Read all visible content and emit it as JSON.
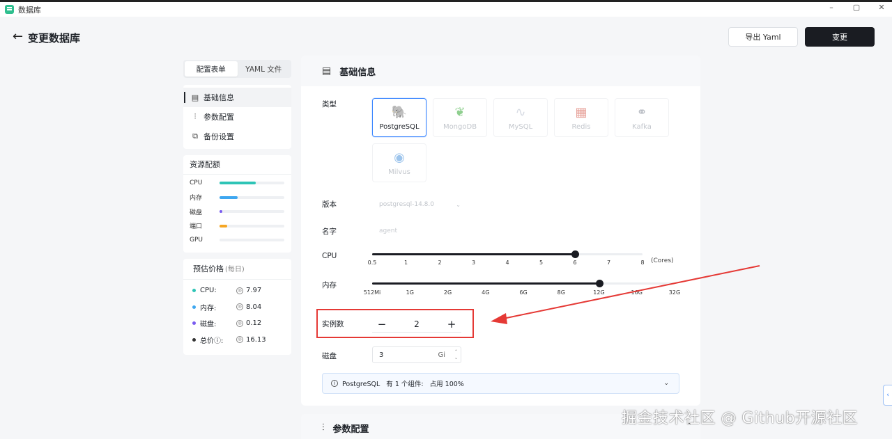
{
  "window": {
    "app_title": "数据库",
    "minimize": "–",
    "maximize": "▢",
    "close": "✕"
  },
  "header": {
    "back_icon": "←",
    "title": "变更数据库",
    "export_label": "导出 Yaml",
    "submit_label": "变更"
  },
  "mode_tabs": [
    {
      "label": "配置表单",
      "active": true
    },
    {
      "label": "YAML 文件",
      "active": false
    }
  ],
  "nav": [
    {
      "label": "基础信息",
      "icon": "form-icon",
      "active": true
    },
    {
      "label": "参数配置",
      "icon": "sliders-icon",
      "active": false
    },
    {
      "label": "备份设置",
      "icon": "backup-icon",
      "active": false
    }
  ],
  "resources": {
    "title": "资源配额",
    "items": [
      {
        "label": "CPU",
        "fraction": 0.56,
        "color": "#2ec4b6"
      },
      {
        "label": "内存",
        "fraction": 0.28,
        "color": "#3ea7f0"
      },
      {
        "label": "磁盘",
        "fraction": 0.04,
        "color": "#7a5cf0"
      },
      {
        "label": "端口",
        "fraction": 0.12,
        "color": "#f5a623"
      },
      {
        "label": "GPU",
        "fraction": 0.0,
        "color": "#cccccc"
      }
    ]
  },
  "price": {
    "title": "预估价格",
    "subtitle": "(每日)",
    "items": [
      {
        "label": "CPU:",
        "value": "7.97",
        "color": "#2ec4b6"
      },
      {
        "label": "内存:",
        "value": "8.04",
        "color": "#3ea7f0"
      },
      {
        "label": "磁盘:",
        "value": "0.12",
        "color": "#7a5cf0"
      },
      {
        "label": "总价ⓘ:",
        "value": "16.13",
        "color": "#333333"
      }
    ]
  },
  "basic": {
    "title": "基础信息",
    "type_label": "类型",
    "db_types": [
      {
        "name": "PostgreSQL",
        "icon": "postgresql-icon",
        "active": true
      },
      {
        "name": "MongoDB",
        "icon": "mongodb-icon",
        "active": false
      },
      {
        "name": "MySQL",
        "icon": "mysql-icon",
        "active": false
      },
      {
        "name": "Redis",
        "icon": "redis-icon",
        "active": false
      },
      {
        "name": "Kafka",
        "icon": "kafka-icon",
        "active": false
      },
      {
        "name": "Milvus",
        "icon": "milvus-icon",
        "active": false
      }
    ],
    "version_label": "版本",
    "version_value": "postgresql-14.8.0",
    "name_label": "名字",
    "name_value": "agent",
    "cpu_label": "CPU",
    "cpu_ticks": [
      "0.5",
      "1",
      "2",
      "3",
      "4",
      "5",
      "6",
      "7",
      "8"
    ],
    "cpu_selected": "6",
    "cpu_unit": "(Cores)",
    "mem_label": "内存",
    "mem_ticks": [
      "512Mi",
      "1G",
      "2G",
      "4G",
      "6G",
      "8G",
      "12G",
      "16G",
      "32G"
    ],
    "mem_selected": "12G",
    "replicas_label": "实例数",
    "replicas_value": "2",
    "minus": "−",
    "plus": "+",
    "disk_label": "磁盘",
    "disk_value": "3",
    "disk_unit": "Gi",
    "info_text": "PostgreSQL   有 1 个组件:   占用 100%"
  },
  "params": {
    "title": "参数配置"
  },
  "watermark": "掘金技术社区 @ Github开源社区"
}
